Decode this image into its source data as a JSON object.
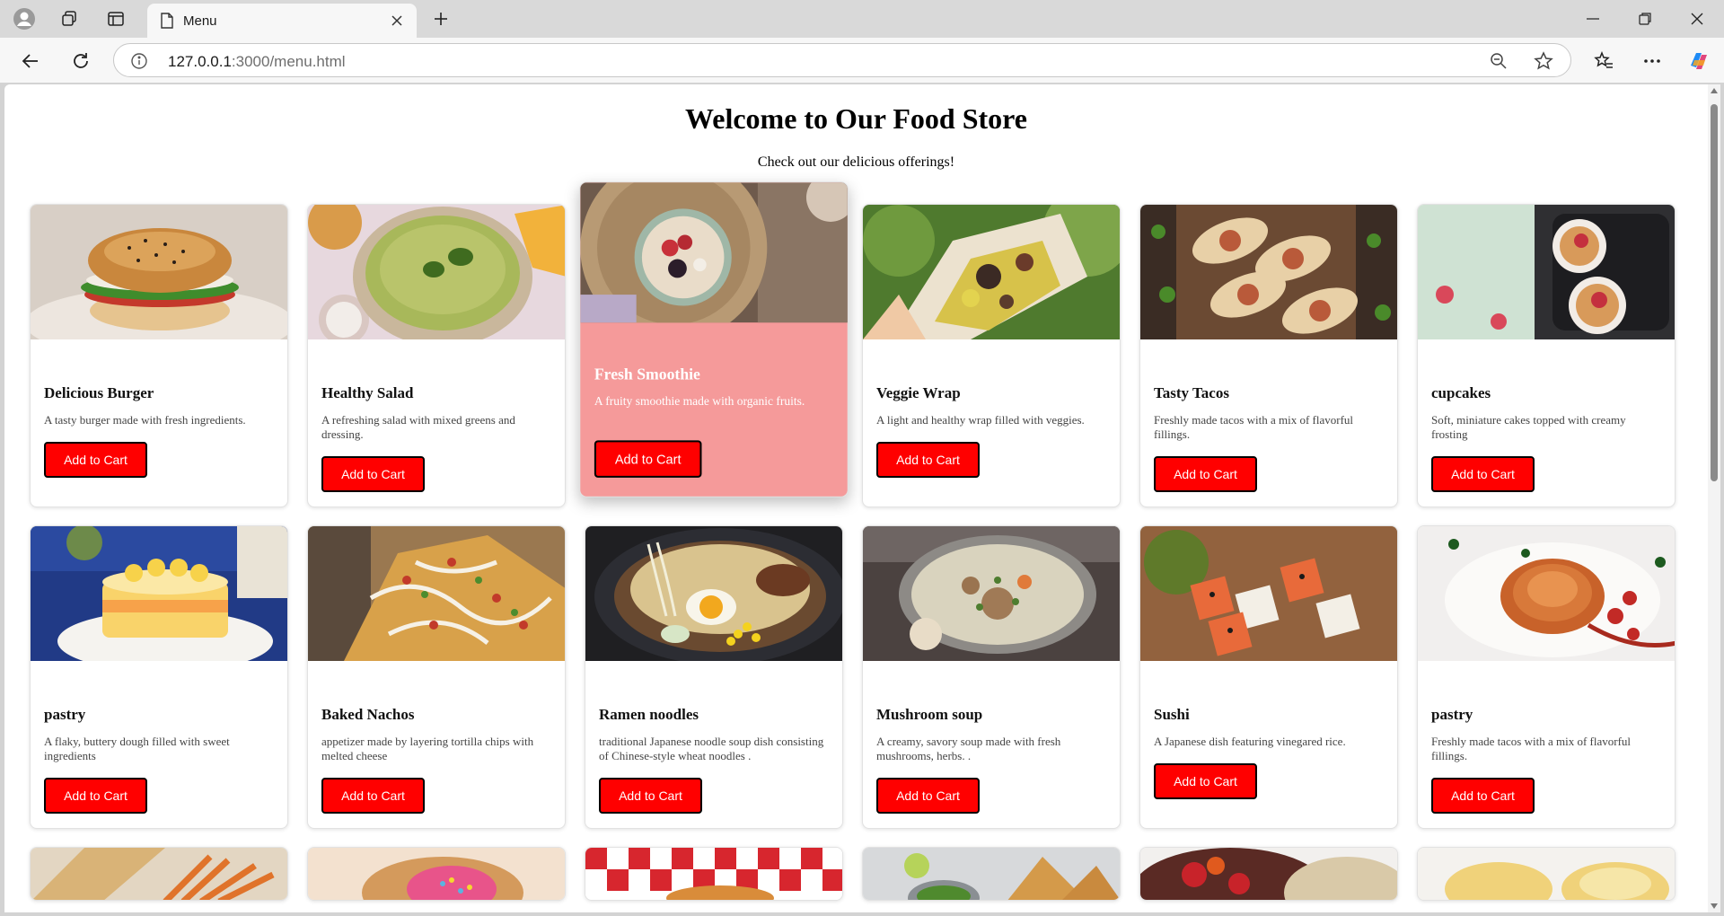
{
  "browser": {
    "tab_title": "Menu",
    "url_host": "127.0.0.1",
    "url_path": ":3000/menu.html"
  },
  "page": {
    "title": "Welcome to Our Food Store",
    "subtitle": "Check out our delicious offerings!"
  },
  "colors": {
    "button": "#ff0000",
    "hover_card": "#f59a9a"
  },
  "items": [
    {
      "name": "Delicious Burger",
      "desc": "A tasty burger made with fresh ingredients.",
      "button": "Add to Cart",
      "image": "burger-image"
    },
    {
      "name": "Healthy Salad",
      "desc": "A refreshing salad with mixed greens and dressing.",
      "button": "Add to Cart",
      "image": "guacamole-image"
    },
    {
      "name": "Fresh Smoothie",
      "desc": "A fruity smoothie made with organic fruits.",
      "button": "Add to Cart",
      "image": "smoothie-bowl-image"
    },
    {
      "name": "Veggie Wrap",
      "desc": "A light and healthy wrap filled with veggies.",
      "button": "Add to Cart",
      "image": "wrap-image"
    },
    {
      "name": "Tasty Tacos",
      "desc": "Freshly made tacos with a mix of flavorful fillings.",
      "button": "Add to Cart",
      "image": "tacos-image"
    },
    {
      "name": "cupcakes",
      "desc": "Soft, miniature cakes topped with creamy frosting",
      "button": "Add to Cart",
      "image": "cupcakes-image"
    },
    {
      "name": "pastry",
      "desc": "A flaky, buttery dough filled with sweet ingredients",
      "button": "Add to Cart",
      "image": "cake-image"
    },
    {
      "name": "Baked Nachos",
      "desc": "appetizer made by layering tortilla chips with melted cheese",
      "button": "Add to Cart",
      "image": "nachos-image"
    },
    {
      "name": "Ramen noodles",
      "desc": "traditional Japanese noodle soup dish consisting of Chinese-style wheat noodles .",
      "button": "Add to Cart",
      "image": "ramen-image"
    },
    {
      "name": "Mushroom soup",
      "desc": "A creamy, savory soup made with fresh mushrooms, herbs. .",
      "button": "Add to Cart",
      "image": "soup-image"
    },
    {
      "name": "Sushi",
      "desc": "A Japanese dish featuring vinegared rice.",
      "button": "Add to Cart",
      "image": "sushi-image"
    },
    {
      "name": "pastry",
      "desc": "Freshly made tacos with a mix of flavorful fillings.",
      "button": "Add to Cart",
      "image": "spaghetti-image"
    }
  ]
}
